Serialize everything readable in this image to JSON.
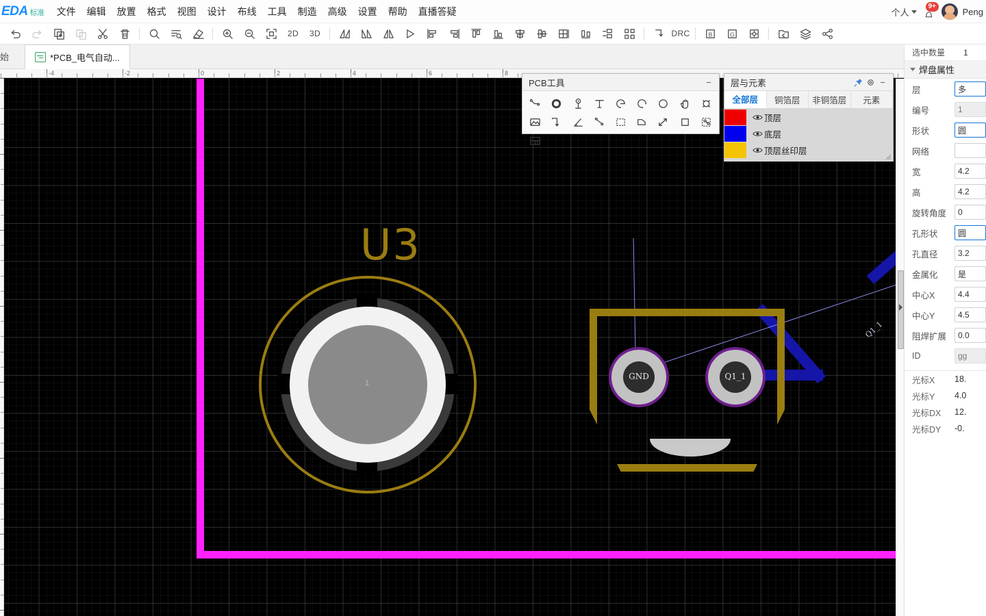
{
  "app": {
    "logo_main": "EDA",
    "logo_sub": "标准",
    "menu": [
      "文件",
      "编辑",
      "放置",
      "格式",
      "视图",
      "设计",
      "布线",
      "工具",
      "制造",
      "高级",
      "设置",
      "帮助",
      "直播答疑"
    ],
    "account_label": "个人",
    "notification_badge": "9+",
    "username": "Peng"
  },
  "toolbar": {
    "groups": [
      [
        {
          "name": "undo-icon",
          "icon": "undo",
          "dim": false
        },
        {
          "name": "redo-icon",
          "icon": "redo",
          "dim": true
        },
        {
          "name": "copy-icon",
          "icon": "copy",
          "dim": false
        },
        {
          "name": "paste-icon",
          "icon": "paste",
          "dim": true
        },
        {
          "name": "cut-icon",
          "icon": "scissors",
          "dim": false
        },
        {
          "name": "delete-icon",
          "icon": "trash",
          "dim": false
        }
      ],
      [
        {
          "name": "search-icon",
          "icon": "search",
          "dim": false
        },
        {
          "name": "find-list-icon",
          "icon": "findlist",
          "dim": false
        },
        {
          "name": "eraser-icon",
          "icon": "eraser",
          "dim": false
        }
      ],
      [
        {
          "name": "zoom-in-icon",
          "icon": "zoomin",
          "dim": false
        },
        {
          "name": "zoom-out-icon",
          "icon": "zoomout",
          "dim": false
        },
        {
          "name": "fit-view-icon",
          "icon": "fit",
          "dim": false
        },
        {
          "name": "view-2d-button",
          "icon": "text",
          "label": "2D",
          "dim": false
        },
        {
          "name": "view-3d-button",
          "icon": "text",
          "label": "3D",
          "dim": false
        }
      ],
      [
        {
          "name": "flip-horizontal-icon",
          "icon": "flip1",
          "dim": false
        },
        {
          "name": "flip-vertical-icon",
          "icon": "flip2",
          "dim": false
        },
        {
          "name": "mirror-icon",
          "icon": "mirror",
          "dim": false
        },
        {
          "name": "rotate-icon",
          "icon": "rotate",
          "dim": false
        },
        {
          "name": "align-left-icon",
          "icon": "alignleft",
          "dim": false
        },
        {
          "name": "align-right-icon",
          "icon": "alignright",
          "dim": false
        },
        {
          "name": "align-top-icon",
          "icon": "aligntop",
          "dim": false
        },
        {
          "name": "align-bottom-icon",
          "icon": "alignbottom",
          "dim": false
        },
        {
          "name": "align-center-h-icon",
          "icon": "centerh",
          "dim": false
        },
        {
          "name": "align-center-v-icon",
          "icon": "centerv",
          "dim": false
        },
        {
          "name": "grid-align-icon",
          "icon": "gridalign",
          "dim": false
        },
        {
          "name": "distribute-h-icon",
          "icon": "disth",
          "dim": false
        },
        {
          "name": "distribute-v-icon",
          "icon": "distv",
          "dim": false
        },
        {
          "name": "arrange-icon",
          "icon": "arrange",
          "dim": false
        }
      ],
      [
        {
          "name": "reroute-icon",
          "icon": "reroute",
          "dim": false
        },
        {
          "name": "drc-button",
          "icon": "text",
          "label": "DRC",
          "dim": false
        }
      ],
      [
        {
          "name": "bottom-layer-icon",
          "icon": "boxB",
          "label": "B",
          "dim": false
        },
        {
          "name": "ground-layer-icon",
          "icon": "boxG",
          "label": "G",
          "dim": false
        },
        {
          "name": "origin-icon",
          "icon": "boxO",
          "dim": false
        }
      ],
      [
        {
          "name": "restore-icon",
          "icon": "restore",
          "dim": false
        },
        {
          "name": "layers-icon",
          "icon": "layers",
          "dim": false
        },
        {
          "name": "share-icon",
          "icon": "share",
          "dim": false
        }
      ]
    ]
  },
  "tabs": [
    {
      "label": "始",
      "active": false,
      "has_icon": false
    },
    {
      "label": "*PCB_电气自动...",
      "active": true,
      "has_icon": true
    }
  ],
  "canvas": {
    "ruler_labels": [
      "-4",
      "-2",
      "0",
      "2",
      "4",
      "6",
      "8"
    ],
    "components": [
      {
        "name": "U3",
        "designator": "U3",
        "pin_label": "1"
      },
      {
        "name": "Q1",
        "pads": [
          {
            "label": "GND"
          },
          {
            "label": "Q1_1"
          }
        ]
      }
    ],
    "trace_label": "Q1_1"
  },
  "pcb_tools": {
    "title": "PCB工具",
    "minimize": "−",
    "tools": [
      {
        "name": "route-track-tool",
        "icon": "track"
      },
      {
        "name": "via-tool",
        "icon": "via"
      },
      {
        "name": "pad-tool",
        "icon": "pad"
      },
      {
        "name": "text-tool",
        "icon": "textT"
      },
      {
        "name": "arc-tool",
        "icon": "arc1"
      },
      {
        "name": "arc3-tool",
        "icon": "arc2"
      },
      {
        "name": "circle-tool",
        "icon": "circle"
      },
      {
        "name": "drag-tool",
        "icon": "hand"
      },
      {
        "name": "hole-tool",
        "icon": "hole"
      },
      {
        "name": "image-tool",
        "icon": "image"
      },
      {
        "name": "line-tool",
        "icon": "corner"
      },
      {
        "name": "angle-tool",
        "icon": "angle"
      },
      {
        "name": "polyline-tool",
        "icon": "polyline"
      },
      {
        "name": "select-area-tool",
        "icon": "dashbox"
      },
      {
        "name": "polygon-tool",
        "icon": "poly"
      },
      {
        "name": "measure-tool",
        "icon": "measure"
      },
      {
        "name": "rect-tool",
        "icon": "rect"
      },
      {
        "name": "copper-area-tool",
        "icon": "copper"
      },
      {
        "name": "table-tool",
        "icon": "table"
      }
    ]
  },
  "layers_panel": {
    "title": "层与元素",
    "pin": "pin-icon",
    "settings": "gear-icon",
    "minimize": "−",
    "tabs": [
      {
        "label": "全部层",
        "active": true
      },
      {
        "label": "铜箔层",
        "active": false
      },
      {
        "label": "非铜箔层",
        "active": false
      },
      {
        "label": "元素",
        "active": false
      }
    ],
    "layers": [
      {
        "name": "顶层",
        "color": "#ee0000",
        "visible": true
      },
      {
        "name": "底层",
        "color": "#0000ee",
        "visible": true
      },
      {
        "name": "顶层丝印层",
        "color": "#f5c400",
        "visible": true
      }
    ]
  },
  "properties": {
    "selected_label": "选中数量",
    "selected_count": "1",
    "section_title": "焊盘属性",
    "rows": [
      {
        "label": "层",
        "value": "多",
        "readonly": false,
        "selected": true
      },
      {
        "label": "编号",
        "value": "1",
        "readonly": true,
        "selected": false
      },
      {
        "label": "形状",
        "value": "圆",
        "readonly": false,
        "selected": true
      },
      {
        "label": "网络",
        "value": "",
        "readonly": false,
        "selected": false
      },
      {
        "label": "宽",
        "value": "4.2",
        "readonly": false,
        "selected": false
      },
      {
        "label": "高",
        "value": "4.2",
        "readonly": false,
        "selected": false
      },
      {
        "label": "旋转角度",
        "value": "0",
        "readonly": false,
        "selected": false
      },
      {
        "label": "孔形状",
        "value": "圆",
        "readonly": false,
        "selected": true
      },
      {
        "label": "孔直径",
        "value": "3.2",
        "readonly": false,
        "selected": false
      },
      {
        "label": "金属化",
        "value": "是",
        "readonly": false,
        "selected": false
      },
      {
        "label": "中心X",
        "value": "4.4",
        "readonly": false,
        "selected": false
      },
      {
        "label": "中心Y",
        "value": "4.5",
        "readonly": false,
        "selected": false
      },
      {
        "label": "阻焊扩展",
        "value": "0.0",
        "readonly": false,
        "selected": false
      },
      {
        "label": "ID",
        "value": "gg",
        "readonly": true,
        "selected": false
      }
    ],
    "cursor": [
      {
        "label": "光标X",
        "value": "18."
      },
      {
        "label": "光标Y",
        "value": "4.0"
      },
      {
        "label": "光标DX",
        "value": "12."
      },
      {
        "label": "光标DY",
        "value": "-0."
      }
    ]
  }
}
